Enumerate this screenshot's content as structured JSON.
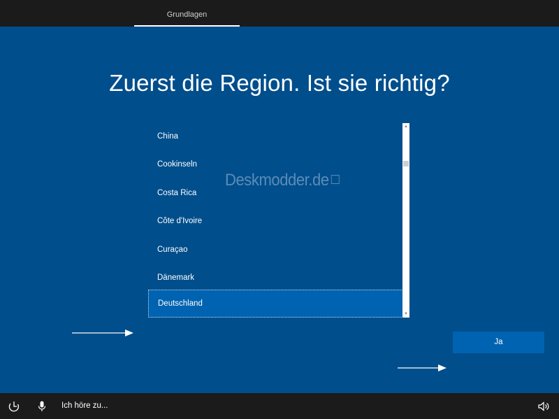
{
  "topbar": {
    "tab_label": "Grundlagen"
  },
  "main": {
    "headline": "Zuerst die Region. Ist sie richtig?",
    "region_list": [
      {
        "label": "China",
        "selected": false
      },
      {
        "label": "Cookinseln",
        "selected": false
      },
      {
        "label": "Costa Rica",
        "selected": false
      },
      {
        "label": "Côte d'Ivoire",
        "selected": false
      },
      {
        "label": "Curaçao",
        "selected": false
      },
      {
        "label": "Dänemark",
        "selected": false
      },
      {
        "label": "Deutschland",
        "selected": true
      }
    ],
    "watermark": "Deskmodder.de",
    "confirm_button_label": "Ja"
  },
  "bottombar": {
    "listening_text": "Ich höre zu...",
    "icons": [
      "ease-of-access-icon",
      "microphone-icon",
      "volume-icon"
    ]
  },
  "colors": {
    "background_blue": "#004e8c",
    "accent_blue": "#0063b1",
    "bar_dark": "#1b1b1b"
  }
}
